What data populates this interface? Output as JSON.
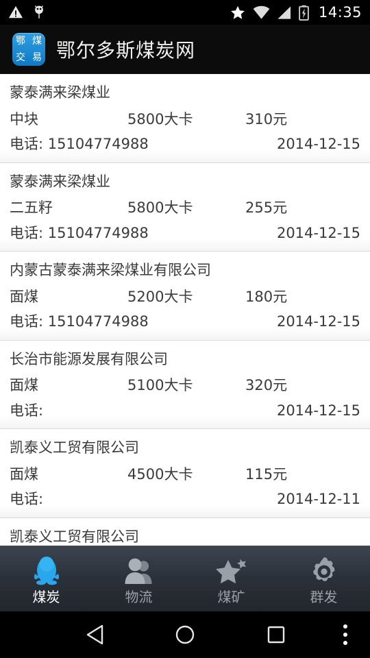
{
  "status_bar": {
    "time": "14:35",
    "left_icons": [
      "warning-icon",
      "android-debug-icon"
    ],
    "right_icons": [
      "star-icon",
      "wifi-icon",
      "signal-icon",
      "battery-charging-icon"
    ]
  },
  "app_bar": {
    "icon_chars": [
      "鄂",
      "煤",
      "交",
      "易"
    ],
    "title": "鄂尔多斯煤炭网",
    "icon_color": "#1e8fd5"
  },
  "list": {
    "items": [
      {
        "company": "蒙泰满来梁煤业",
        "coal_type": "中块",
        "calorific": "5800大卡",
        "price": "310元",
        "phone": "电话: 15104774988",
        "date": "2014-12-15"
      },
      {
        "company": "蒙泰满来梁煤业",
        "coal_type": "二五籽",
        "calorific": "5800大卡",
        "price": "255元",
        "phone": "电话: 15104774988",
        "date": "2014-12-15"
      },
      {
        "company": "内蒙古蒙泰满来梁煤业有限公司",
        "coal_type": "面煤",
        "calorific": "5200大卡",
        "price": "180元",
        "phone": "电话: 15104774988",
        "date": "2014-12-15"
      },
      {
        "company": "长治市能源发展有限公司",
        "coal_type": "面煤",
        "calorific": "5100大卡",
        "price": "320元",
        "phone": "电话:",
        "date": "2014-12-15"
      },
      {
        "company": "凯泰义工贸有限公司",
        "coal_type": "面煤",
        "calorific": "4500大卡",
        "price": "115元",
        "phone": "电话:",
        "date": "2014-12-11"
      },
      {
        "company": "凯泰义工贸有限公司",
        "coal_type": "",
        "calorific": "",
        "price": "",
        "phone": "",
        "date": ""
      }
    ]
  },
  "tab_bar": {
    "active_index": 0,
    "active_color": "#2aa7ec",
    "inactive_color": "#9aa0a8",
    "tabs": [
      {
        "label": "煤炭",
        "icon": "penguin-icon"
      },
      {
        "label": "物流",
        "icon": "people-icon"
      },
      {
        "label": "煤矿",
        "icon": "star-icon"
      },
      {
        "label": "群发",
        "icon": "gear-icon"
      }
    ]
  },
  "nav_bar": {
    "buttons": [
      {
        "name": "back",
        "icon": "back-triangle-icon"
      },
      {
        "name": "home",
        "icon": "home-circle-icon"
      },
      {
        "name": "recents",
        "icon": "recents-square-icon"
      },
      {
        "name": "more",
        "icon": "overflow-dots-icon"
      }
    ]
  }
}
